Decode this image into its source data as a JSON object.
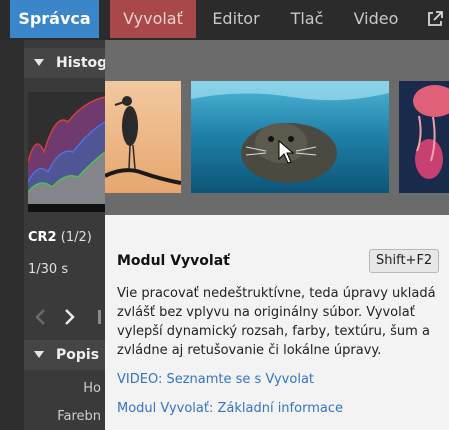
{
  "top_tabs": [
    {
      "label": "Správca",
      "state": "active"
    },
    {
      "label": "Vyvolať",
      "state": "hover"
    },
    {
      "label": "Editor",
      "state": "normal"
    },
    {
      "label": "Tlač",
      "state": "normal"
    },
    {
      "label": "Video",
      "state": "normal"
    }
  ],
  "top_icons": {
    "external": "external-link-icon"
  },
  "left_panel": {
    "histogram_title": "Histogram",
    "file_format": "CR2",
    "file_index": "(1/2)",
    "exposure": "1/30 s",
    "description_title": "Popis",
    "desc_rows": [
      "Ho",
      "Farebn"
    ]
  },
  "tooltip": {
    "title": "Modul Vyvolať",
    "shortcut": "Shift+F2",
    "text": "Vie pracovať nedeštruktívne, teda úpravy ukladá\nzvlášť bez vplyvu na originálny súbor. Vyvolať\nvylepší dynamický rozsah, farby, textúru, šum a\nzvládne aj retušovanie či lokálne úpravy.",
    "links": [
      "VIDEO: Seznamte se s Vyvolat",
      "Modul Vyvolať: Základní informace"
    ]
  },
  "preview_images": [
    "heron-at-sunset",
    "sea-lion-underwater",
    "jellyfish"
  ],
  "colors": {
    "accent": "#3b86c9",
    "hover_tab": "#a84848",
    "link": "#3474c2"
  }
}
